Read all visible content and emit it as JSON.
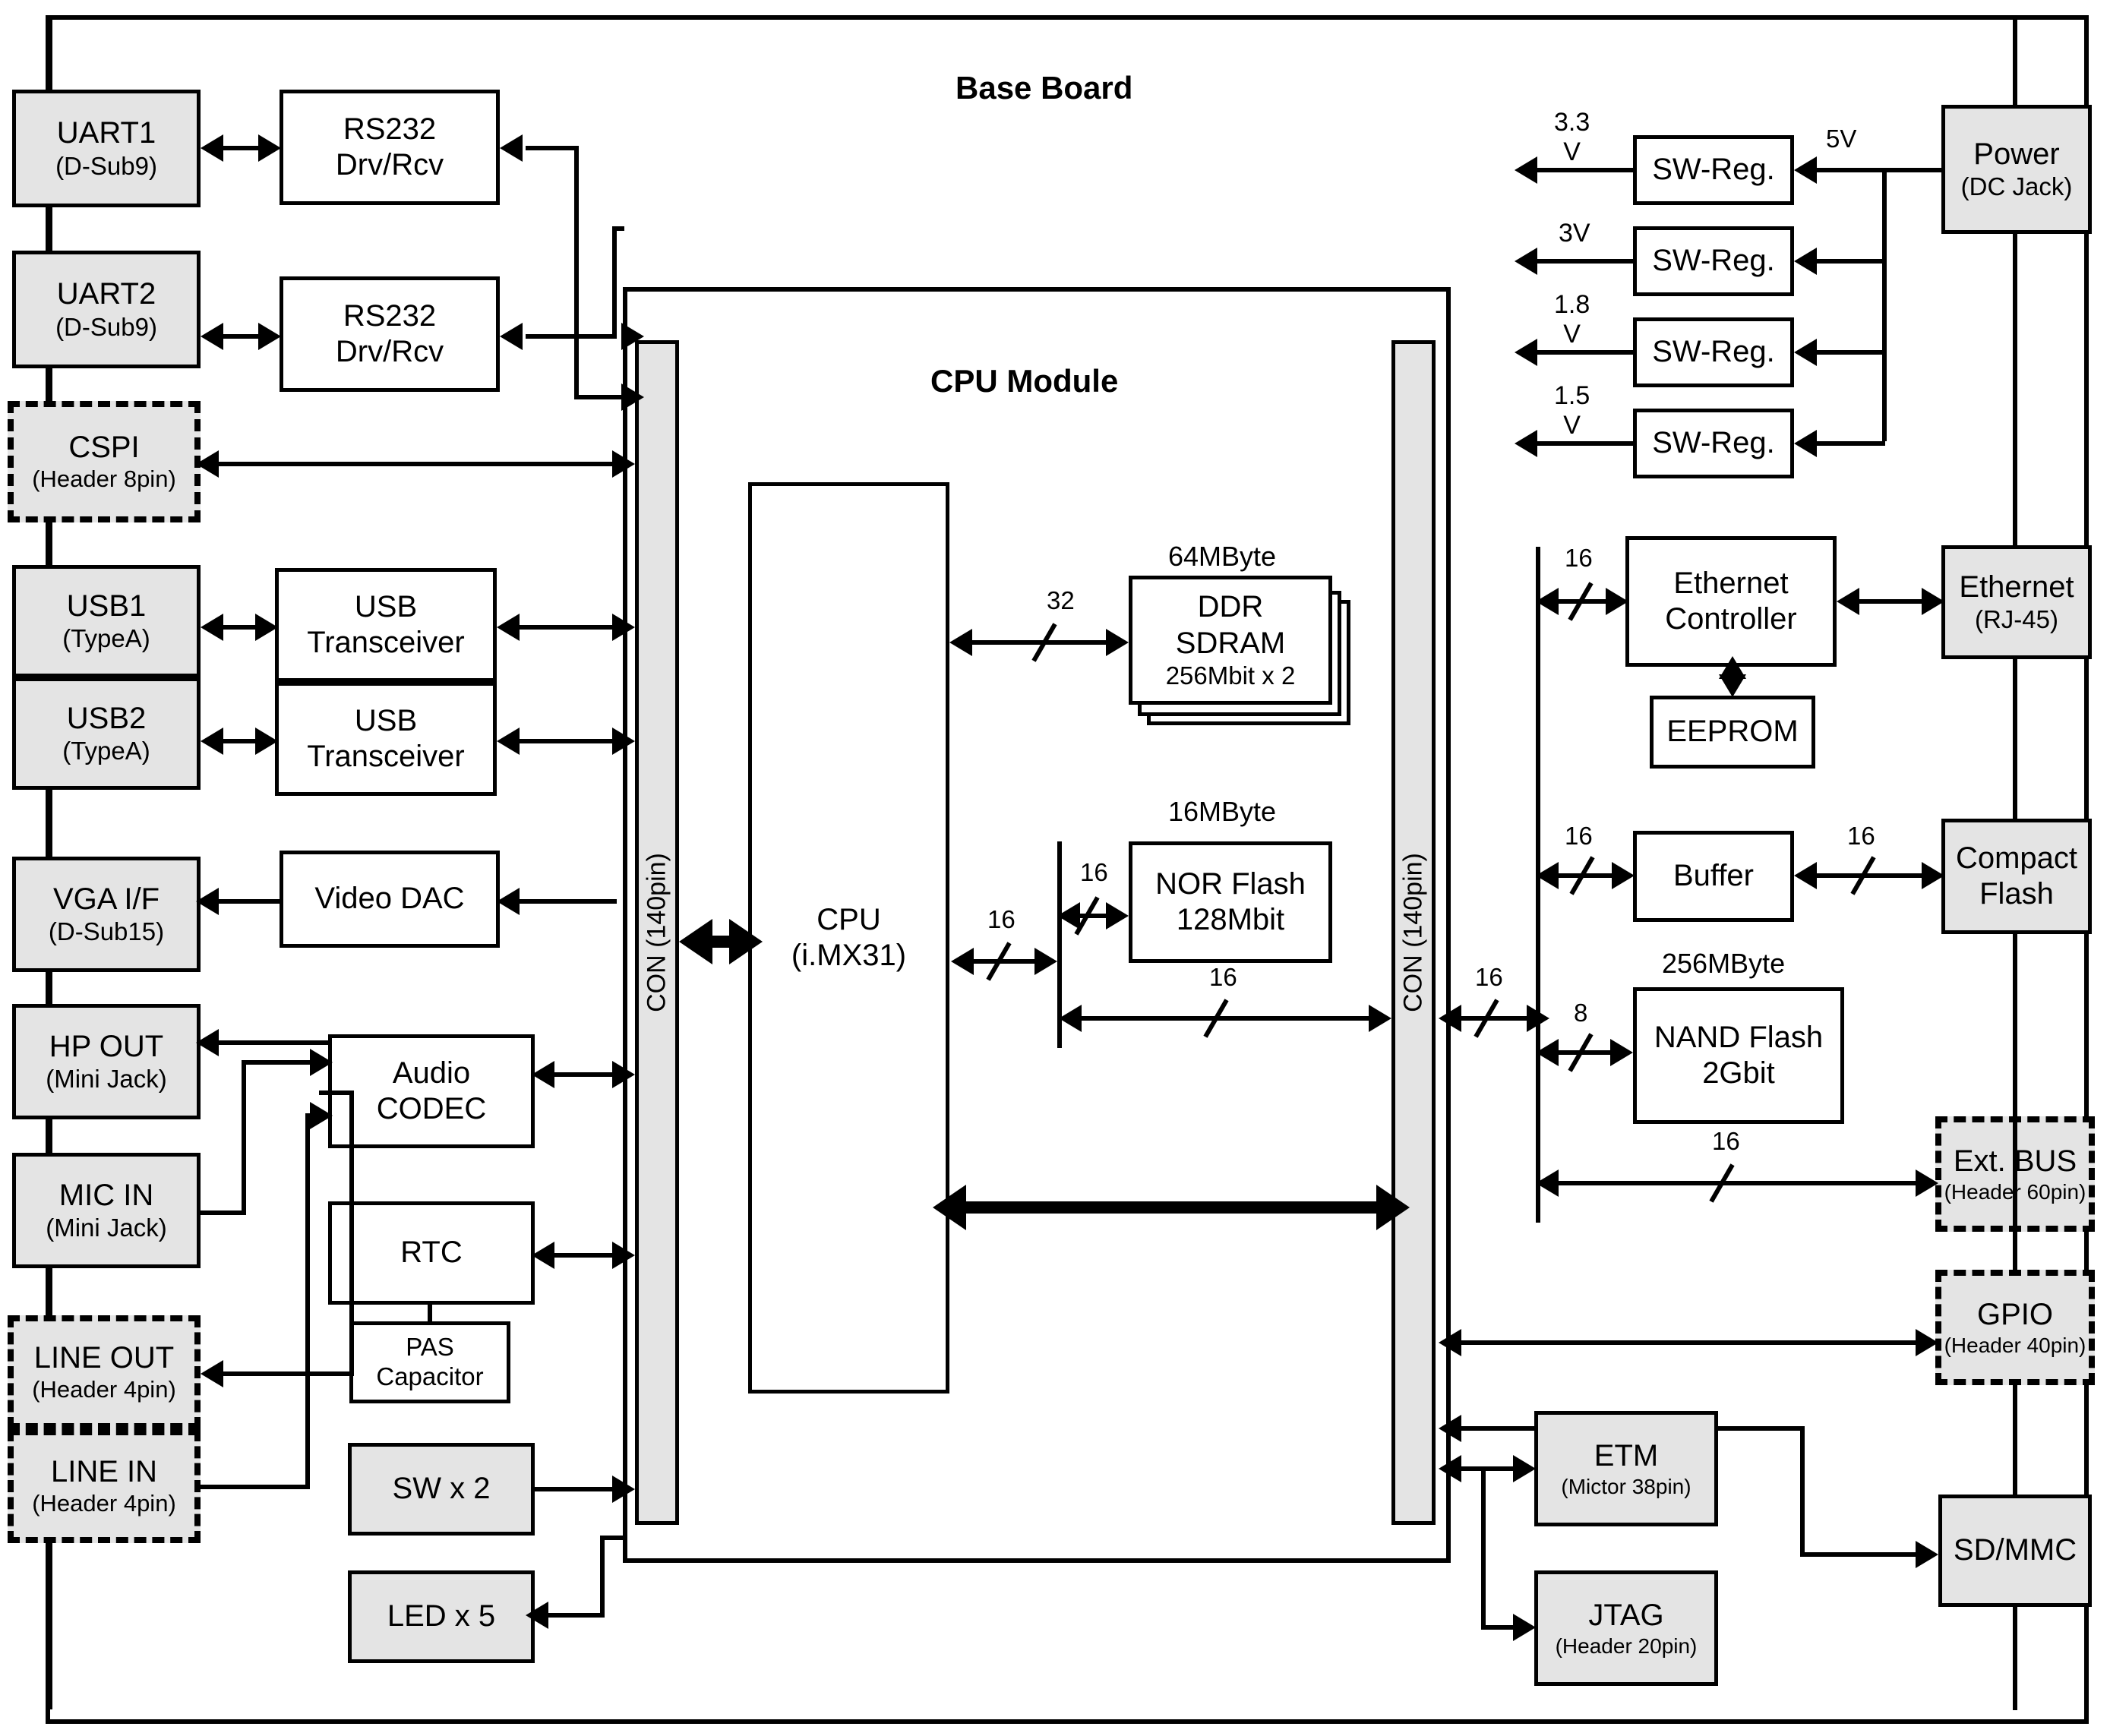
{
  "title": "i.MX31 CPU Module / Base Board block diagram",
  "regions": {
    "base_board": {
      "label": "Base Board"
    },
    "cpu_module": {
      "label": "CPU Module"
    }
  },
  "connectors": {
    "left": "CON (140pin)",
    "right": "CON (140pin)"
  },
  "blocks": {
    "uart1": {
      "line1": "UART1",
      "line2": "(D-Sub9)"
    },
    "uart2": {
      "line1": "UART2",
      "line2": "(D-Sub9)"
    },
    "rs232_1": {
      "line1": "RS232",
      "line2": "Drv/Rcv"
    },
    "rs232_2": {
      "line1": "RS232",
      "line2": "Drv/Rcv"
    },
    "cspi": {
      "line1": "CSPI",
      "line2": "(Header 8pin)"
    },
    "usb1": {
      "line1": "USB1",
      "line2": "(TypeA)"
    },
    "usb2": {
      "line1": "USB2",
      "line2": "(TypeA)"
    },
    "usb_trx1": {
      "line1": "USB",
      "line2": "Transceiver"
    },
    "usb_trx2": {
      "line1": "USB",
      "line2": "Transceiver"
    },
    "vga": {
      "line1": "VGA I/F",
      "line2": "(D-Sub15)"
    },
    "video_dac": {
      "line1": "Video DAC"
    },
    "hp_out": {
      "line1": "HP OUT",
      "line2": "(Mini Jack)"
    },
    "mic_in": {
      "line1": "MIC IN",
      "line2": "(Mini Jack)"
    },
    "audio_codec": {
      "line1": "Audio",
      "line2": "CODEC"
    },
    "line_out": {
      "line1": "LINE OUT",
      "line2": "(Header 4pin)"
    },
    "line_in": {
      "line1": "LINE IN",
      "line2": "(Header 4pin)"
    },
    "rtc": {
      "line1": "RTC"
    },
    "pas_cap": {
      "line1": "PAS",
      "line2": "Capacitor"
    },
    "sw": {
      "line1": "SW x 2"
    },
    "led": {
      "line1": "LED x 5"
    },
    "cpu": {
      "line1": "CPU",
      "line2": "(i.MX31)"
    },
    "ddr": {
      "cap": "64MByte",
      "line1": "DDR",
      "line2": "SDRAM",
      "line3": "256Mbit x 2"
    },
    "nor": {
      "cap": "16MByte",
      "line1": "NOR Flash",
      "line2": "128Mbit"
    },
    "nand": {
      "cap": "256MByte",
      "line1": "NAND Flash",
      "line2": "2Gbit"
    },
    "power": {
      "line1": "Power",
      "line2": "(DC Jack)"
    },
    "swreg1": {
      "line1": "SW-Reg."
    },
    "swreg2": {
      "line1": "SW-Reg."
    },
    "swreg3": {
      "line1": "SW-Reg."
    },
    "swreg4": {
      "line1": "SW-Reg."
    },
    "eth_ctrl": {
      "line1": "Ethernet",
      "line2": "Controller"
    },
    "eeprom": {
      "line1": "EEPROM"
    },
    "ethernet": {
      "line1": "Ethernet",
      "line2": "(RJ-45)"
    },
    "buffer": {
      "line1": "Buffer"
    },
    "cf": {
      "line1": "Compact",
      "line2": "Flash"
    },
    "ext_bus": {
      "line1": "Ext. BUS",
      "line2": "(Header 60pin)"
    },
    "gpio": {
      "line1": "GPIO",
      "line2": "(Header 40pin)"
    },
    "sdmmc": {
      "line1": "SD/MMC"
    },
    "etm": {
      "line1": "ETM",
      "line2": "(Mictor 38pin)"
    },
    "jtag": {
      "line1": "JTAG",
      "line2": "(Header 20pin)"
    }
  },
  "bus_labels": {
    "ddr": "32",
    "nor": "16",
    "cpu_left": "16",
    "nor_bottom": "16",
    "con_right": "16",
    "eth": "16",
    "buffer_left": "16",
    "buffer_right": "16",
    "nand": "8",
    "extbus": "16"
  },
  "voltages": {
    "v5": "5V",
    "v33": {
      "num": "3.3",
      "unit": "V"
    },
    "v3": {
      "num": "3V",
      "unit": ""
    },
    "v18": {
      "num": "1.8",
      "unit": "V"
    },
    "v15": {
      "num": "1.5",
      "unit": "V"
    }
  },
  "chart_data": {
    "type": "diagram",
    "title": "i.MX31 CPU Module / Base Board block diagram",
    "nodes": [
      "UART1 (D-Sub9)",
      "UART2 (D-Sub9)",
      "RS232 Drv/Rcv",
      "RS232 Drv/Rcv",
      "CSPI (Header 8pin)",
      "USB1 (TypeA)",
      "USB2 (TypeA)",
      "USB Transceiver",
      "USB Transceiver",
      "VGA I/F (D-Sub15)",
      "Video DAC",
      "HP OUT (Mini Jack)",
      "MIC IN (Mini Jack)",
      "Audio CODEC",
      "LINE OUT (Header 4pin)",
      "LINE IN (Header 4pin)",
      "RTC",
      "PAS Capacitor",
      "SW x 2",
      "LED x 5",
      "CON (140pin)",
      "CPU (i.MX31)",
      "DDR SDRAM 256Mbit x 2 (64MByte)",
      "NOR Flash 128Mbit (16MByte)",
      "NAND Flash 2Gbit (256MByte)",
      "Power (DC Jack)",
      "SW-Reg.",
      "Ethernet Controller",
      "EEPROM",
      "Ethernet (RJ-45)",
      "Buffer",
      "Compact Flash",
      "Ext. BUS (Header 60pin)",
      "GPIO (Header 40pin)",
      "SD/MMC",
      "ETM (Mictor 38pin)",
      "JTAG (Header 20pin)"
    ]
  }
}
